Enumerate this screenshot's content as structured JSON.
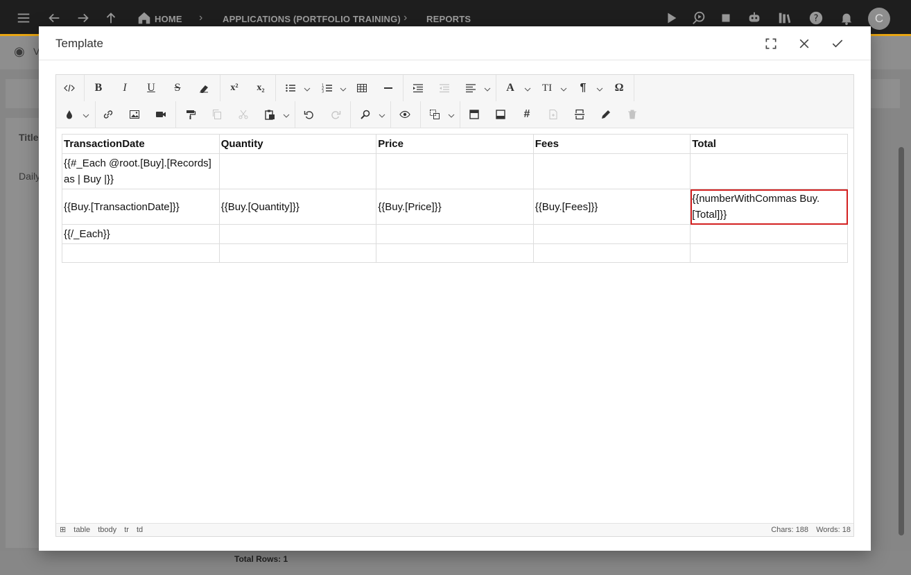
{
  "topbar": {
    "breadcrumbs": [
      "HOME",
      "APPLICATIONS (PORTFOLIO TRAINING)",
      "REPORTS"
    ],
    "avatar_letter": "C"
  },
  "background": {
    "view_label": "V",
    "tab_label": "Title",
    "row_label": "Daily",
    "total_rows": "Total Rows: 1"
  },
  "dialog": {
    "title": "Template"
  },
  "table": {
    "headers": [
      "TransactionDate",
      "Quantity",
      "Price",
      "Fees",
      "Total"
    ],
    "rows": [
      [
        "{{#_Each @root.[Buy].[Records] as | Buy |}}",
        "",
        "",
        "",
        ""
      ],
      [
        "{{Buy.[TransactionDate]}}",
        "{{Buy.[Quantity]}}",
        "{{Buy.[Price]}}",
        "{{Buy.[Fees]}}",
        "{{numberWithCommas Buy.[Total]}}"
      ],
      [
        "{{/_Each}}",
        "",
        "",
        "",
        ""
      ],
      [
        "",
        "",
        "",
        "",
        ""
      ]
    ]
  },
  "statusbar": {
    "path": [
      "table",
      "tbody",
      "tr",
      "td"
    ],
    "chars": "Chars: 188",
    "words": "Words: 18"
  },
  "toolbar": {
    "superscript": "x²",
    "subscript": "x₂",
    "omega": "Ω",
    "font_color": "A",
    "font_size": "TI",
    "paragraph": "¶"
  }
}
